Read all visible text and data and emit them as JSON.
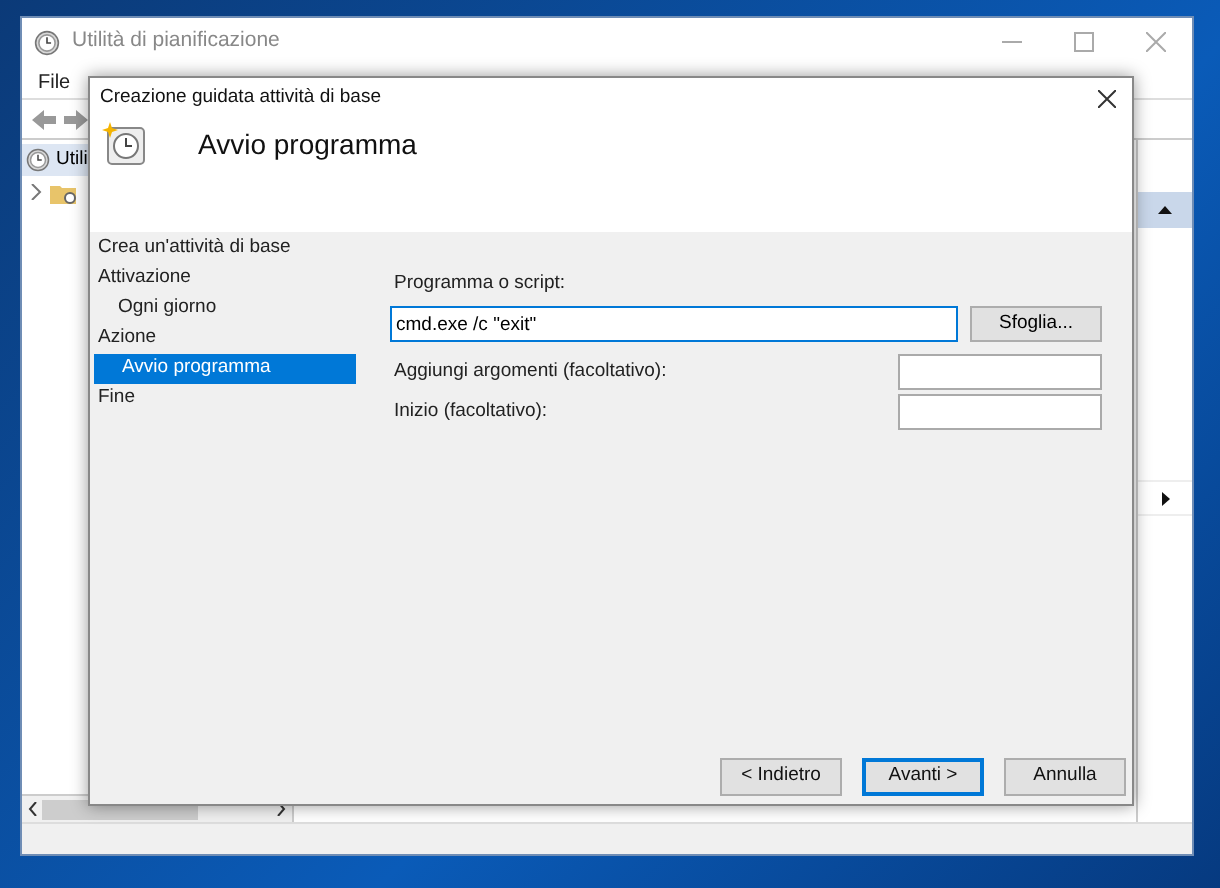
{
  "main_window": {
    "title": "Utilità di pianificazione",
    "menu": [
      "File"
    ],
    "tree": [
      {
        "label": "Utili"
      }
    ]
  },
  "dialog": {
    "title": "Creazione guidata attività di base",
    "heading": "Avvio programma",
    "steps": [
      {
        "label": "Crea un'attività di base",
        "selected": false
      },
      {
        "label": "Attivazione",
        "selected": false,
        "children": [
          {
            "label": "Ogni giorno",
            "selected": false
          }
        ]
      },
      {
        "label": "Azione",
        "selected": false,
        "children": [
          {
            "label": "Avvio programma",
            "selected": true
          }
        ]
      },
      {
        "label": "Fine",
        "selected": false
      }
    ],
    "fields": [
      {
        "kind": "wide",
        "label": "Programma o script:",
        "value": "cmd.exe /c \"exit\"",
        "focused": true,
        "button": "Sfoglia..."
      },
      {
        "kind": "inline",
        "label": "Aggiungi argomenti (facoltativo):",
        "focused": false
      },
      {
        "kind": "inline",
        "label": "Inizio (facoltativo):",
        "focused": false
      }
    ],
    "buttons": [
      {
        "label": "< Indietro",
        "default": false
      },
      {
        "label": "Avanti >",
        "default": true
      },
      {
        "label": "Annulla",
        "default": false
      }
    ]
  }
}
